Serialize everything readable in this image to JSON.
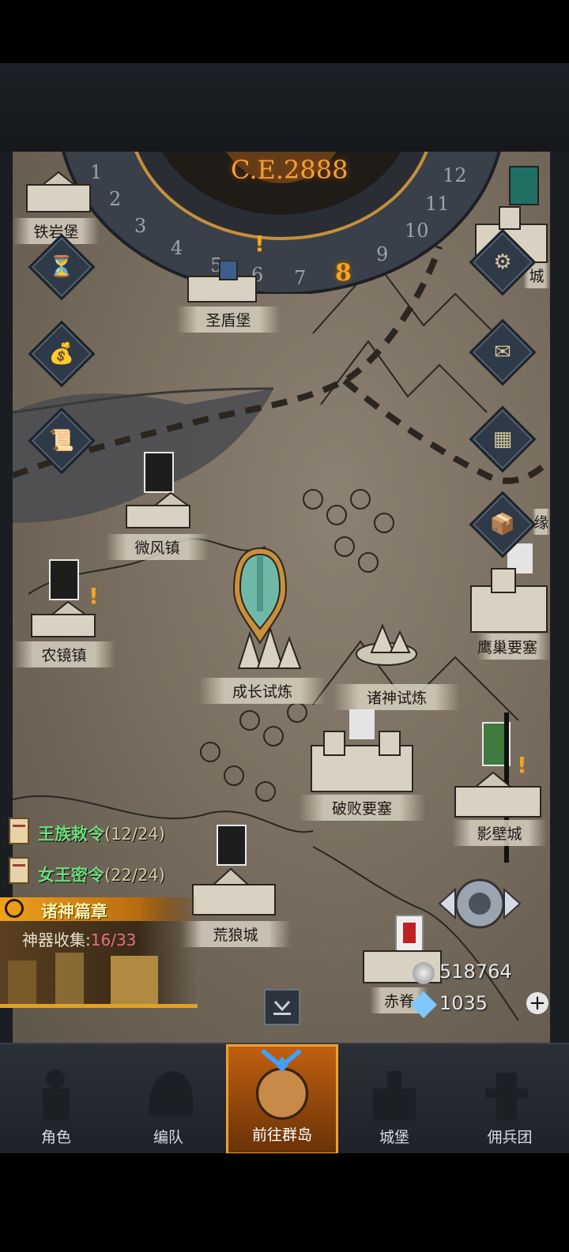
{
  "calendar": {
    "era_label": "C.E.2888",
    "month_numbers": [
      "1",
      "2",
      "3",
      "4",
      "5",
      "6",
      "7",
      "8",
      "9",
      "10",
      "11",
      "12"
    ],
    "current_month": "8"
  },
  "locations": [
    {
      "id": "tieyan",
      "name": "铁岩堡"
    },
    {
      "id": "shengdun",
      "name": "圣盾堡"
    },
    {
      "id": "weifeng",
      "name": "微风镇"
    },
    {
      "id": "nongjing",
      "name": "农镜镇"
    },
    {
      "id": "chengzhang",
      "name": "成长试炼"
    },
    {
      "id": "zhushen",
      "name": "诸神试炼"
    },
    {
      "id": "yingchao",
      "name": "鹰巢要塞"
    },
    {
      "id": "pobai",
      "name": "破败要塞"
    },
    {
      "id": "yingbi",
      "name": "影壁城"
    },
    {
      "id": "huanglang",
      "name": "荒狼城"
    },
    {
      "id": "chiji",
      "name": "赤脊"
    },
    {
      "id": "edge_cheng",
      "name": "城"
    },
    {
      "id": "edge_yuan",
      "name": "缘"
    }
  ],
  "side_menu_left": [
    {
      "icon": "hourglass-icon"
    },
    {
      "icon": "money-bag-icon"
    },
    {
      "icon": "scroll-icon"
    }
  ],
  "side_menu_right": [
    {
      "icon": "gear-icon"
    },
    {
      "icon": "mail-icon"
    },
    {
      "icon": "grid-icon"
    },
    {
      "icon": "supplies-icon"
    }
  ],
  "quests": [
    {
      "title": "王族敕令",
      "progress": "(12/24)"
    },
    {
      "title": "女王密令",
      "progress": "(22/24)"
    }
  ],
  "chapter": {
    "title": "诸神篇章",
    "subtitle_label": "神器收集:",
    "subtitle_value": "16/33"
  },
  "resources": {
    "silver": "518764",
    "diamond": "1035"
  },
  "nav": [
    {
      "label": "角色",
      "icon": "knight-icon"
    },
    {
      "label": "编队",
      "icon": "helmet-icon"
    },
    {
      "label": "前往群岛",
      "icon": "globe-icon",
      "active": true
    },
    {
      "label": "城堡",
      "icon": "castle-icon"
    },
    {
      "label": "佣兵团",
      "icon": "mercenary-icon"
    }
  ],
  "colors": {
    "accent_orange": "#f3a51f",
    "quest_green": "#6edb7d",
    "chapter_yellow": "#f5d24a",
    "progress_red": "#e46f86"
  }
}
